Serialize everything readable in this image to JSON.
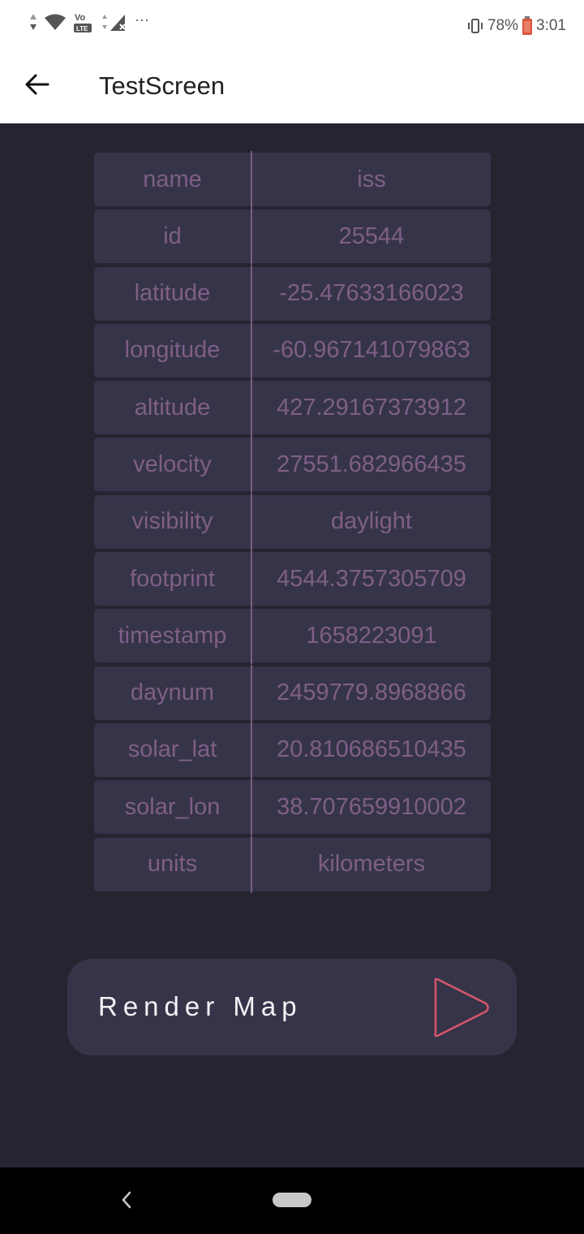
{
  "status_bar": {
    "dots": "···",
    "battery_percent": "78%",
    "time": "3:01",
    "volte_label": "Vo",
    "lte_label": "LTE"
  },
  "app_bar": {
    "title": "TestScreen"
  },
  "table": {
    "rows": [
      {
        "key": "name",
        "value": "iss"
      },
      {
        "key": "id",
        "value": "25544"
      },
      {
        "key": "latitude",
        "value": "-25.47633166023"
      },
      {
        "key": "longitude",
        "value": "-60.967141079863"
      },
      {
        "key": "altitude",
        "value": "427.29167373912"
      },
      {
        "key": "velocity",
        "value": "27551.682966435"
      },
      {
        "key": "visibility",
        "value": "daylight"
      },
      {
        "key": "footprint",
        "value": "4544.3757305709"
      },
      {
        "key": "timestamp",
        "value": "1658223091"
      },
      {
        "key": "daynum",
        "value": "2459779.8968866"
      },
      {
        "key": "solar_lat",
        "value": "20.810686510435"
      },
      {
        "key": "solar_lon",
        "value": "38.707659910002"
      },
      {
        "key": "units",
        "value": "kilometers"
      }
    ]
  },
  "render_button": {
    "label": "Render Map",
    "icon": "play-icon",
    "accent_color": "#d6566a"
  },
  "colors": {
    "background": "#252532",
    "row_background": "#363449",
    "table_text": "#7e5f87"
  }
}
